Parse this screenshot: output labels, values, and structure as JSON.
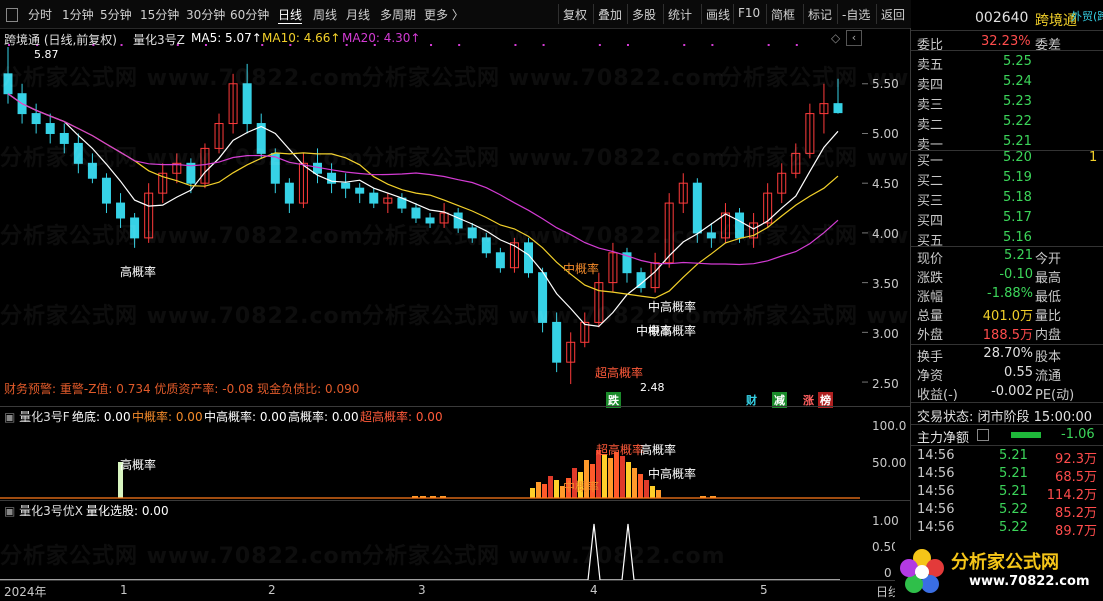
{
  "toolbar": {
    "periods": [
      "分时",
      "1分钟",
      "5分钟",
      "15分钟",
      "30分钟",
      "60分钟",
      "日线",
      "周线",
      "月线",
      "多周期",
      "更多 〉"
    ],
    "active": "日线",
    "actions": [
      "复权",
      "叠加",
      "多股",
      "统计",
      "画线",
      "F10",
      "简框",
      "标记",
      "-自选",
      "返回"
    ]
  },
  "main_chart": {
    "title": "跨境通 (日线,前复权)",
    "indicator": "量化3号Z",
    "ma5": "MA5: 5.07↑",
    "ma10": "MA10: 4.66↑",
    "ma20": "MA20: 4.30↑",
    "high_label": "5.87",
    "low_label": "2.48",
    "y_ticks": [
      "5.50",
      "5.00",
      "4.50",
      "4.00",
      "3.50",
      "3.00",
      "2.50"
    ],
    "annotations": [
      "高概率",
      "中概率",
      "中高概率",
      "中概率",
      "超高概率",
      "中高概率"
    ],
    "warning": "财务预警: 重警-Z值: 0.734 优质资产率: -0.08 现金负债比: 0.090",
    "markers": [
      "跌",
      "财",
      "减",
      "涨",
      "榜"
    ]
  },
  "panel2": {
    "indicator": "量化3号F",
    "labels": [
      "绝底: 0.00",
      "中概率: 0.00",
      "中高概率: 0.00",
      "高概率: 0.00",
      "超高概率: 0.00"
    ],
    "y_ticks": [
      "100.0",
      "50.00"
    ],
    "annotations": [
      "高概率",
      "超高概率",
      "高概率",
      "中高概率",
      "中概率"
    ]
  },
  "panel3": {
    "indicator": "量化3号优X",
    "label": "量化选股: 0.00",
    "y_ticks": [
      "1.00",
      "0.50",
      "0"
    ]
  },
  "x_axis": {
    "labels": [
      "2024年",
      "1",
      "2",
      "3",
      "4",
      "5"
    ],
    "right": "日线"
  },
  "watermark": "分析家公式网 www.70822.com",
  "right_panel": {
    "code": "002640",
    "name": "跨境通",
    "tag": "外贸(跨",
    "webi_label": "委比",
    "webi_value": "32.23%",
    "weicha_label": "委差",
    "asks": [
      {
        "label": "卖五",
        "price": "5.25",
        "vol": ""
      },
      {
        "label": "卖四",
        "price": "5.24",
        "vol": ""
      },
      {
        "label": "卖三",
        "price": "5.23",
        "vol": ""
      },
      {
        "label": "卖二",
        "price": "5.22",
        "vol": ""
      },
      {
        "label": "卖一",
        "price": "5.21",
        "vol": ""
      }
    ],
    "bids": [
      {
        "label": "买一",
        "price": "5.20",
        "vol": "1"
      },
      {
        "label": "买二",
        "price": "5.19",
        "vol": ""
      },
      {
        "label": "买三",
        "price": "5.18",
        "vol": ""
      },
      {
        "label": "买四",
        "price": "5.17",
        "vol": ""
      },
      {
        "label": "买五",
        "price": "5.16",
        "vol": ""
      }
    ],
    "stats": [
      {
        "k": "现价",
        "v": "5.21",
        "k2": "今开",
        "c": "#3cd55a"
      },
      {
        "k": "涨跌",
        "v": "-0.10",
        "k2": "最高",
        "c": "#3cd55a"
      },
      {
        "k": "涨幅",
        "v": "-1.88%",
        "k2": "最低",
        "c": "#3cd55a"
      },
      {
        "k": "总量",
        "v": "401.0万",
        "k2": "量比",
        "c": "#f2d02a"
      },
      {
        "k": "外盘",
        "v": "188.5万",
        "k2": "内盘",
        "c": "#ff4c4c"
      }
    ],
    "stats2": [
      {
        "k": "换手",
        "v": "28.70%",
        "k2": "股本"
      },
      {
        "k": "净资",
        "v": "0.55",
        "k2": "流通"
      },
      {
        "k": "收益(-)",
        "v": "-0.002",
        "k2": "PE(动)"
      }
    ],
    "trade_state": "交易状态: 闭市阶段 15:00:00",
    "main_flow_label": "主力净额",
    "main_flow_value": "-1.06",
    "ticks": [
      {
        "t": "14:56",
        "p": "5.21",
        "v": "92.3万"
      },
      {
        "t": "14:56",
        "p": "5.21",
        "v": "68.5万"
      },
      {
        "t": "14:56",
        "p": "5.21",
        "v": "114.2万"
      },
      {
        "t": "14:56",
        "p": "5.22",
        "v": "85.2万"
      },
      {
        "t": "14:56",
        "p": "5.22",
        "v": "89.7万"
      }
    ]
  },
  "logo": {
    "title": "分析家公式网",
    "url": "www.70822.com"
  },
  "colors": {
    "up": "#ff3b3b",
    "down": "#36d2e6",
    "ma5": "#ffffff",
    "ma10": "#f2d02a",
    "ma20": "#d33bd3"
  },
  "chart_data": {
    "type": "candlestick",
    "ylim": [
      2.4,
      5.9
    ],
    "ohlc": [
      [
        5.6,
        5.87,
        5.3,
        5.4
      ],
      [
        5.4,
        5.5,
        5.1,
        5.2
      ],
      [
        5.2,
        5.3,
        5.0,
        5.1
      ],
      [
        5.1,
        5.2,
        4.9,
        5.0
      ],
      [
        5.0,
        5.1,
        4.8,
        4.9
      ],
      [
        4.9,
        5.0,
        4.6,
        4.7
      ],
      [
        4.7,
        4.8,
        4.5,
        4.55
      ],
      [
        4.55,
        4.6,
        4.2,
        4.3
      ],
      [
        4.3,
        4.4,
        4.05,
        4.15
      ],
      [
        4.15,
        4.2,
        3.85,
        3.95
      ],
      [
        3.95,
        4.5,
        3.9,
        4.4
      ],
      [
        4.4,
        4.7,
        4.3,
        4.6
      ],
      [
        4.6,
        4.8,
        4.5,
        4.7
      ],
      [
        4.7,
        4.75,
        4.4,
        4.5
      ],
      [
        4.5,
        4.9,
        4.45,
        4.85
      ],
      [
        4.85,
        5.2,
        4.8,
        5.1
      ],
      [
        5.1,
        5.6,
        5.0,
        5.5
      ],
      [
        5.5,
        5.7,
        5.0,
        5.1
      ],
      [
        5.1,
        5.2,
        4.75,
        4.8
      ],
      [
        4.8,
        4.85,
        4.4,
        4.5
      ],
      [
        4.5,
        4.55,
        4.2,
        4.3
      ],
      [
        4.3,
        4.8,
        4.25,
        4.7
      ],
      [
        4.7,
        4.85,
        4.5,
        4.6
      ],
      [
        4.6,
        4.7,
        4.4,
        4.5
      ],
      [
        4.5,
        4.6,
        4.35,
        4.45
      ],
      [
        4.45,
        4.5,
        4.3,
        4.4
      ],
      [
        4.4,
        4.45,
        4.25,
        4.3
      ],
      [
        4.3,
        4.4,
        4.2,
        4.35
      ],
      [
        4.35,
        4.4,
        4.2,
        4.25
      ],
      [
        4.25,
        4.3,
        4.1,
        4.15
      ],
      [
        4.15,
        4.2,
        4.05,
        4.1
      ],
      [
        4.1,
        4.3,
        4.05,
        4.2
      ],
      [
        4.2,
        4.25,
        4.0,
        4.05
      ],
      [
        4.05,
        4.1,
        3.9,
        3.95
      ],
      [
        3.95,
        4.0,
        3.75,
        3.8
      ],
      [
        3.8,
        3.85,
        3.6,
        3.65
      ],
      [
        3.65,
        3.95,
        3.6,
        3.9
      ],
      [
        3.9,
        3.95,
        3.55,
        3.6
      ],
      [
        3.6,
        3.65,
        3.0,
        3.1
      ],
      [
        3.1,
        3.2,
        2.6,
        2.7
      ],
      [
        2.7,
        3.0,
        2.48,
        2.9
      ],
      [
        2.9,
        3.2,
        2.85,
        3.1
      ],
      [
        3.1,
        3.6,
        3.05,
        3.5
      ],
      [
        3.5,
        3.9,
        3.4,
        3.8
      ],
      [
        3.8,
        3.85,
        3.5,
        3.6
      ],
      [
        3.6,
        3.65,
        3.4,
        3.45
      ],
      [
        3.45,
        3.8,
        3.4,
        3.7
      ],
      [
        3.7,
        4.4,
        3.65,
        4.3
      ],
      [
        4.3,
        4.6,
        4.2,
        4.5
      ],
      [
        4.5,
        4.55,
        3.9,
        4.0
      ],
      [
        4.0,
        4.1,
        3.85,
        3.95
      ],
      [
        3.95,
        4.3,
        3.9,
        4.2
      ],
      [
        4.2,
        4.25,
        3.9,
        3.95
      ],
      [
        3.95,
        4.2,
        3.85,
        4.1
      ],
      [
        4.1,
        4.5,
        4.05,
        4.4
      ],
      [
        4.4,
        4.7,
        4.3,
        4.6
      ],
      [
        4.6,
        4.9,
        4.55,
        4.8
      ],
      [
        4.8,
        5.3,
        4.75,
        5.2
      ],
      [
        5.2,
        5.5,
        5.0,
        5.3
      ],
      [
        5.3,
        5.55,
        5.2,
        5.21
      ]
    ]
  }
}
